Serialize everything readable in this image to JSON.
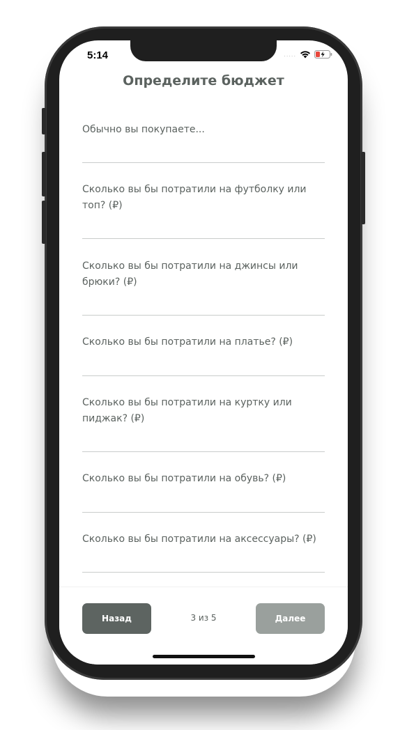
{
  "status_bar": {
    "time": "5:14",
    "signal": "....."
  },
  "header": {
    "title": "Определите бюджет"
  },
  "questions": [
    {
      "label": "Обычно вы покупаете...",
      "value": ""
    },
    {
      "label": "Сколько вы бы потратили на футболку или топ? (₽)",
      "value": ""
    },
    {
      "label": "Сколько вы бы потратили на джинсы или брюки? (₽)",
      "value": ""
    },
    {
      "label": "Сколько вы бы потратили на платье? (₽)",
      "value": ""
    },
    {
      "label": "Сколько вы бы потратили на куртку или пиджак? (₽)",
      "value": ""
    },
    {
      "label": "Сколько вы бы потратили на обувь? (₽)",
      "value": ""
    },
    {
      "label": "Сколько вы бы потратили на аксессуары? (₽)",
      "value": ""
    }
  ],
  "footer": {
    "back_label": "Назад",
    "next_label": "Далее",
    "progress_text": "3 из 5",
    "current_step": 3,
    "total_steps": 5
  },
  "colors": {
    "text": "#5b625f",
    "back_button": "#5d6461",
    "next_button_disabled": "#9aa09d",
    "divider": "#c9cccb"
  },
  "icons": [
    "wifi-icon",
    "battery-charging-icon"
  ]
}
